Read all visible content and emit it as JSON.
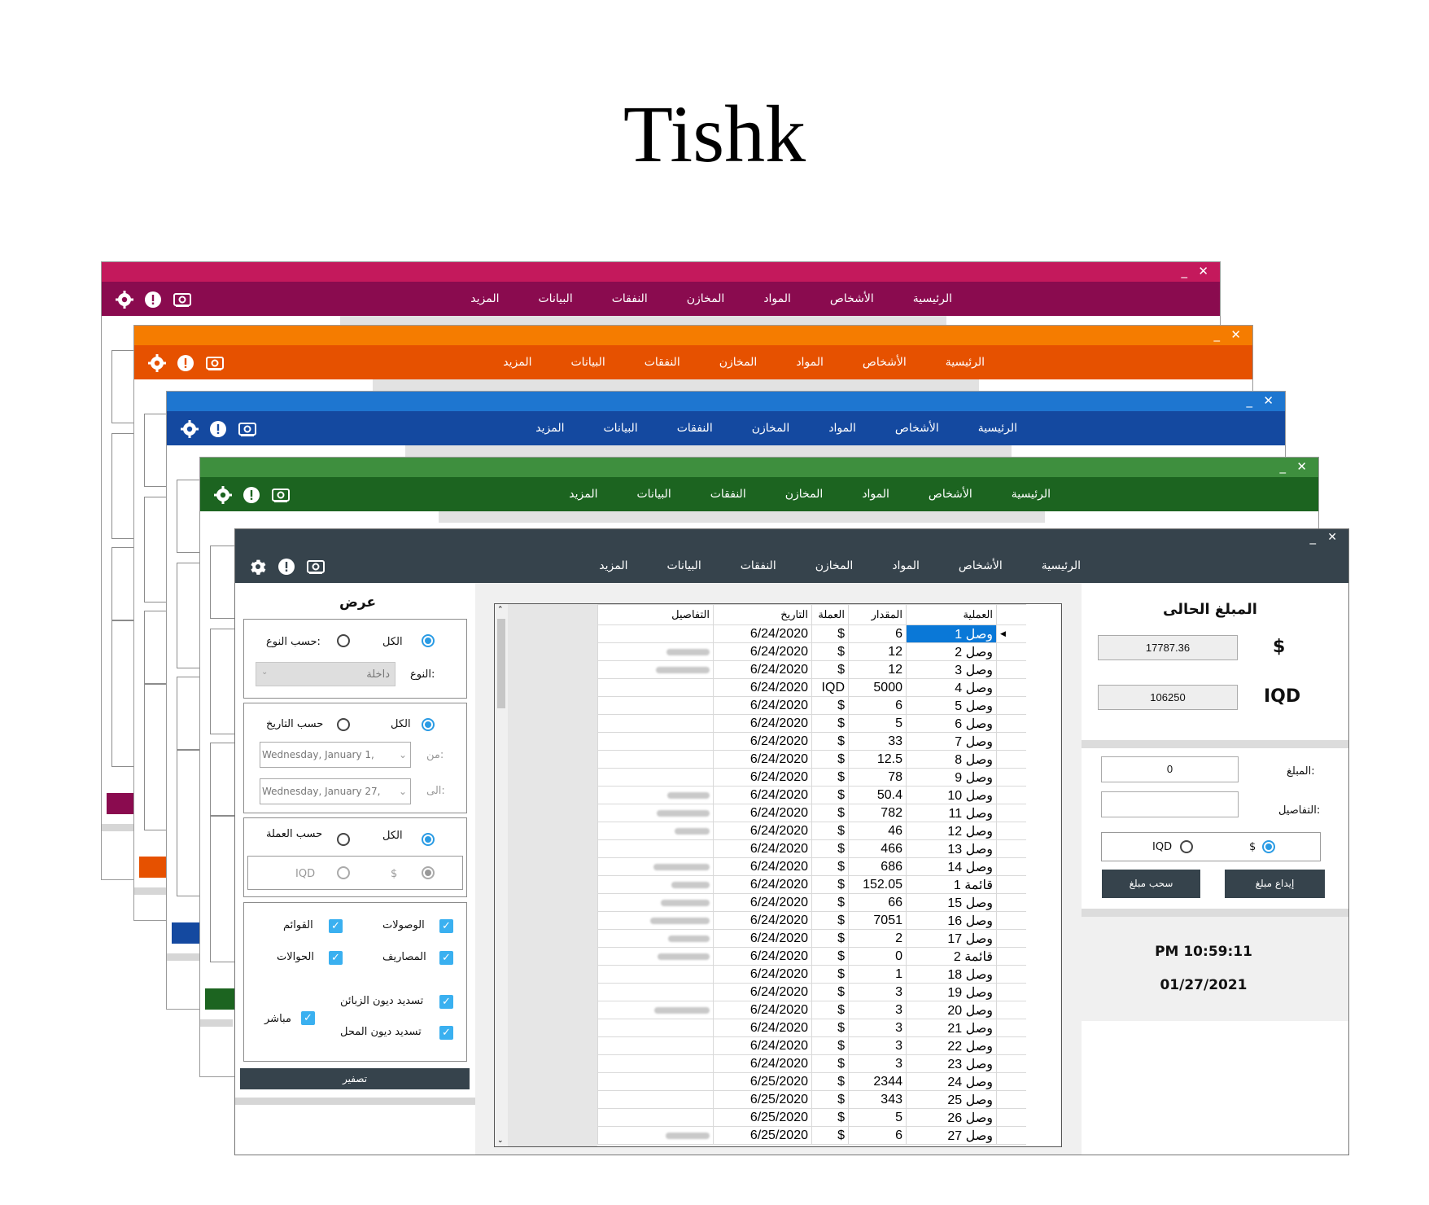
{
  "title": "Tishk",
  "menu": [
    "الرئيسية",
    "الأشخاص",
    "المواد",
    "المخازن",
    "النفقات",
    "البيانات",
    "المزيد"
  ],
  "window_controls": {
    "minimize": "_",
    "close": "✕"
  },
  "themes": [
    {
      "name": "magenta",
      "titlebar": "#c4195c",
      "menubar": "#8a0b4f"
    },
    {
      "name": "orange",
      "titlebar": "#f57c00",
      "menubar": "#e65100"
    },
    {
      "name": "blue",
      "titlebar": "#1e76d0",
      "menubar": "#1449a0"
    },
    {
      "name": "green",
      "titlebar": "#3e8f3e",
      "menubar": "#1c6420"
    },
    {
      "name": "dark",
      "titlebar": "#36434c",
      "menubar": "#36434c"
    }
  ],
  "icons": [
    "gear-icon",
    "alert-icon",
    "cash-icon"
  ],
  "filter": {
    "heading": "عرض",
    "type_group": {
      "all": "الكل",
      "by_type": "حسب النوع:",
      "type_label": "النوع:",
      "type_value": "داخلة"
    },
    "date_group": {
      "all": "الكل",
      "by_date": "حسب التاريخ",
      "from_label": "من:",
      "to_label": "الى:",
      "from_value": "Wednesday,    January      1,",
      "to_value": "Wednesday,    January     27,"
    },
    "currency_group": {
      "all": "الكل",
      "by_currency": "حسب العملة",
      "usd": "$",
      "iqd": "IQD"
    },
    "checks": {
      "receipts": "الوصولات",
      "invoices": "القوائم",
      "expenses": "المصاريف",
      "transfers": "الحوالات",
      "customer_debts": "تسديد ديون الزبائن",
      "direct": "مباشر",
      "shop_debts": "تسديد ديون المحل"
    },
    "reset": "تصفير"
  },
  "grid": {
    "headers": [
      "العملية",
      "المقدار",
      "العملة",
      "التاريخ",
      "التفاصيل"
    ],
    "rows": [
      [
        "وصل 1",
        "6",
        "$",
        "6/24/2020",
        ""
      ],
      [
        "وصل 2",
        "12",
        "$",
        "6/24/2020",
        "blur"
      ],
      [
        "وصل 3",
        "12",
        "$",
        "6/24/2020",
        "blur"
      ],
      [
        "وصل 4",
        "5000",
        "IQD",
        "6/24/2020",
        ""
      ],
      [
        "وصل 5",
        "6",
        "$",
        "6/24/2020",
        ""
      ],
      [
        "وصل 6",
        "5",
        "$",
        "6/24/2020",
        ""
      ],
      [
        "وصل 7",
        "33",
        "$",
        "6/24/2020",
        ""
      ],
      [
        "وصل 8",
        "12.5",
        "$",
        "6/24/2020",
        ""
      ],
      [
        "وصل 9",
        "78",
        "$",
        "6/24/2020",
        ""
      ],
      [
        "وصل 10",
        "50.4",
        "$",
        "6/24/2020",
        "blur"
      ],
      [
        "وصل 11",
        "782",
        "$",
        "6/24/2020",
        "blur"
      ],
      [
        "وصل 12",
        "46",
        "$",
        "6/24/2020",
        "blur"
      ],
      [
        "وصل 13",
        "466",
        "$",
        "6/24/2020",
        ""
      ],
      [
        "وصل 14",
        "686",
        "$",
        "6/24/2020",
        "blur"
      ],
      [
        "قائمة 1",
        "152.05",
        "$",
        "6/24/2020",
        "blur"
      ],
      [
        "وصل 15",
        "66",
        "$",
        "6/24/2020",
        "blur"
      ],
      [
        "وصل 16",
        "7051",
        "$",
        "6/24/2020",
        "blur"
      ],
      [
        "وصل 17",
        "2",
        "$",
        "6/24/2020",
        "blur"
      ],
      [
        "قائمة 2",
        "0",
        "$",
        "6/24/2020",
        "blur"
      ],
      [
        "وصل 18",
        "1",
        "$",
        "6/24/2020",
        ""
      ],
      [
        "وصل 19",
        "3",
        "$",
        "6/24/2020",
        ""
      ],
      [
        "وصل 20",
        "3",
        "$",
        "6/24/2020",
        "blur"
      ],
      [
        "وصل 21",
        "3",
        "$",
        "6/24/2020",
        ""
      ],
      [
        "وصل 22",
        "3",
        "$",
        "6/24/2020",
        ""
      ],
      [
        "وصل 23",
        "3",
        "$",
        "6/24/2020",
        ""
      ],
      [
        "وصل 24",
        "2344",
        "$",
        "6/25/2020",
        ""
      ],
      [
        "وصل 25",
        "343",
        "$",
        "6/25/2020",
        ""
      ],
      [
        "وصل 26",
        "5",
        "$",
        "6/25/2020",
        ""
      ],
      [
        "وصل 27",
        "6",
        "$",
        "6/25/2020",
        "blur"
      ]
    ]
  },
  "balance": {
    "heading": "المبلغ الحالى",
    "usd_symbol": "$",
    "usd_value": "17787.36",
    "iqd_symbol": "IQD",
    "iqd_value": "106250"
  },
  "transaction": {
    "amount_label": "المبلغ:",
    "amount_value": "0",
    "details_label": "التفاصيل:",
    "usd": "$",
    "iqd": "IQD",
    "deposit": "إيداع مبلغ",
    "withdraw": "سحب مبلغ"
  },
  "clock": {
    "time": "PM 10:59:11",
    "date": "01/27/2021"
  }
}
